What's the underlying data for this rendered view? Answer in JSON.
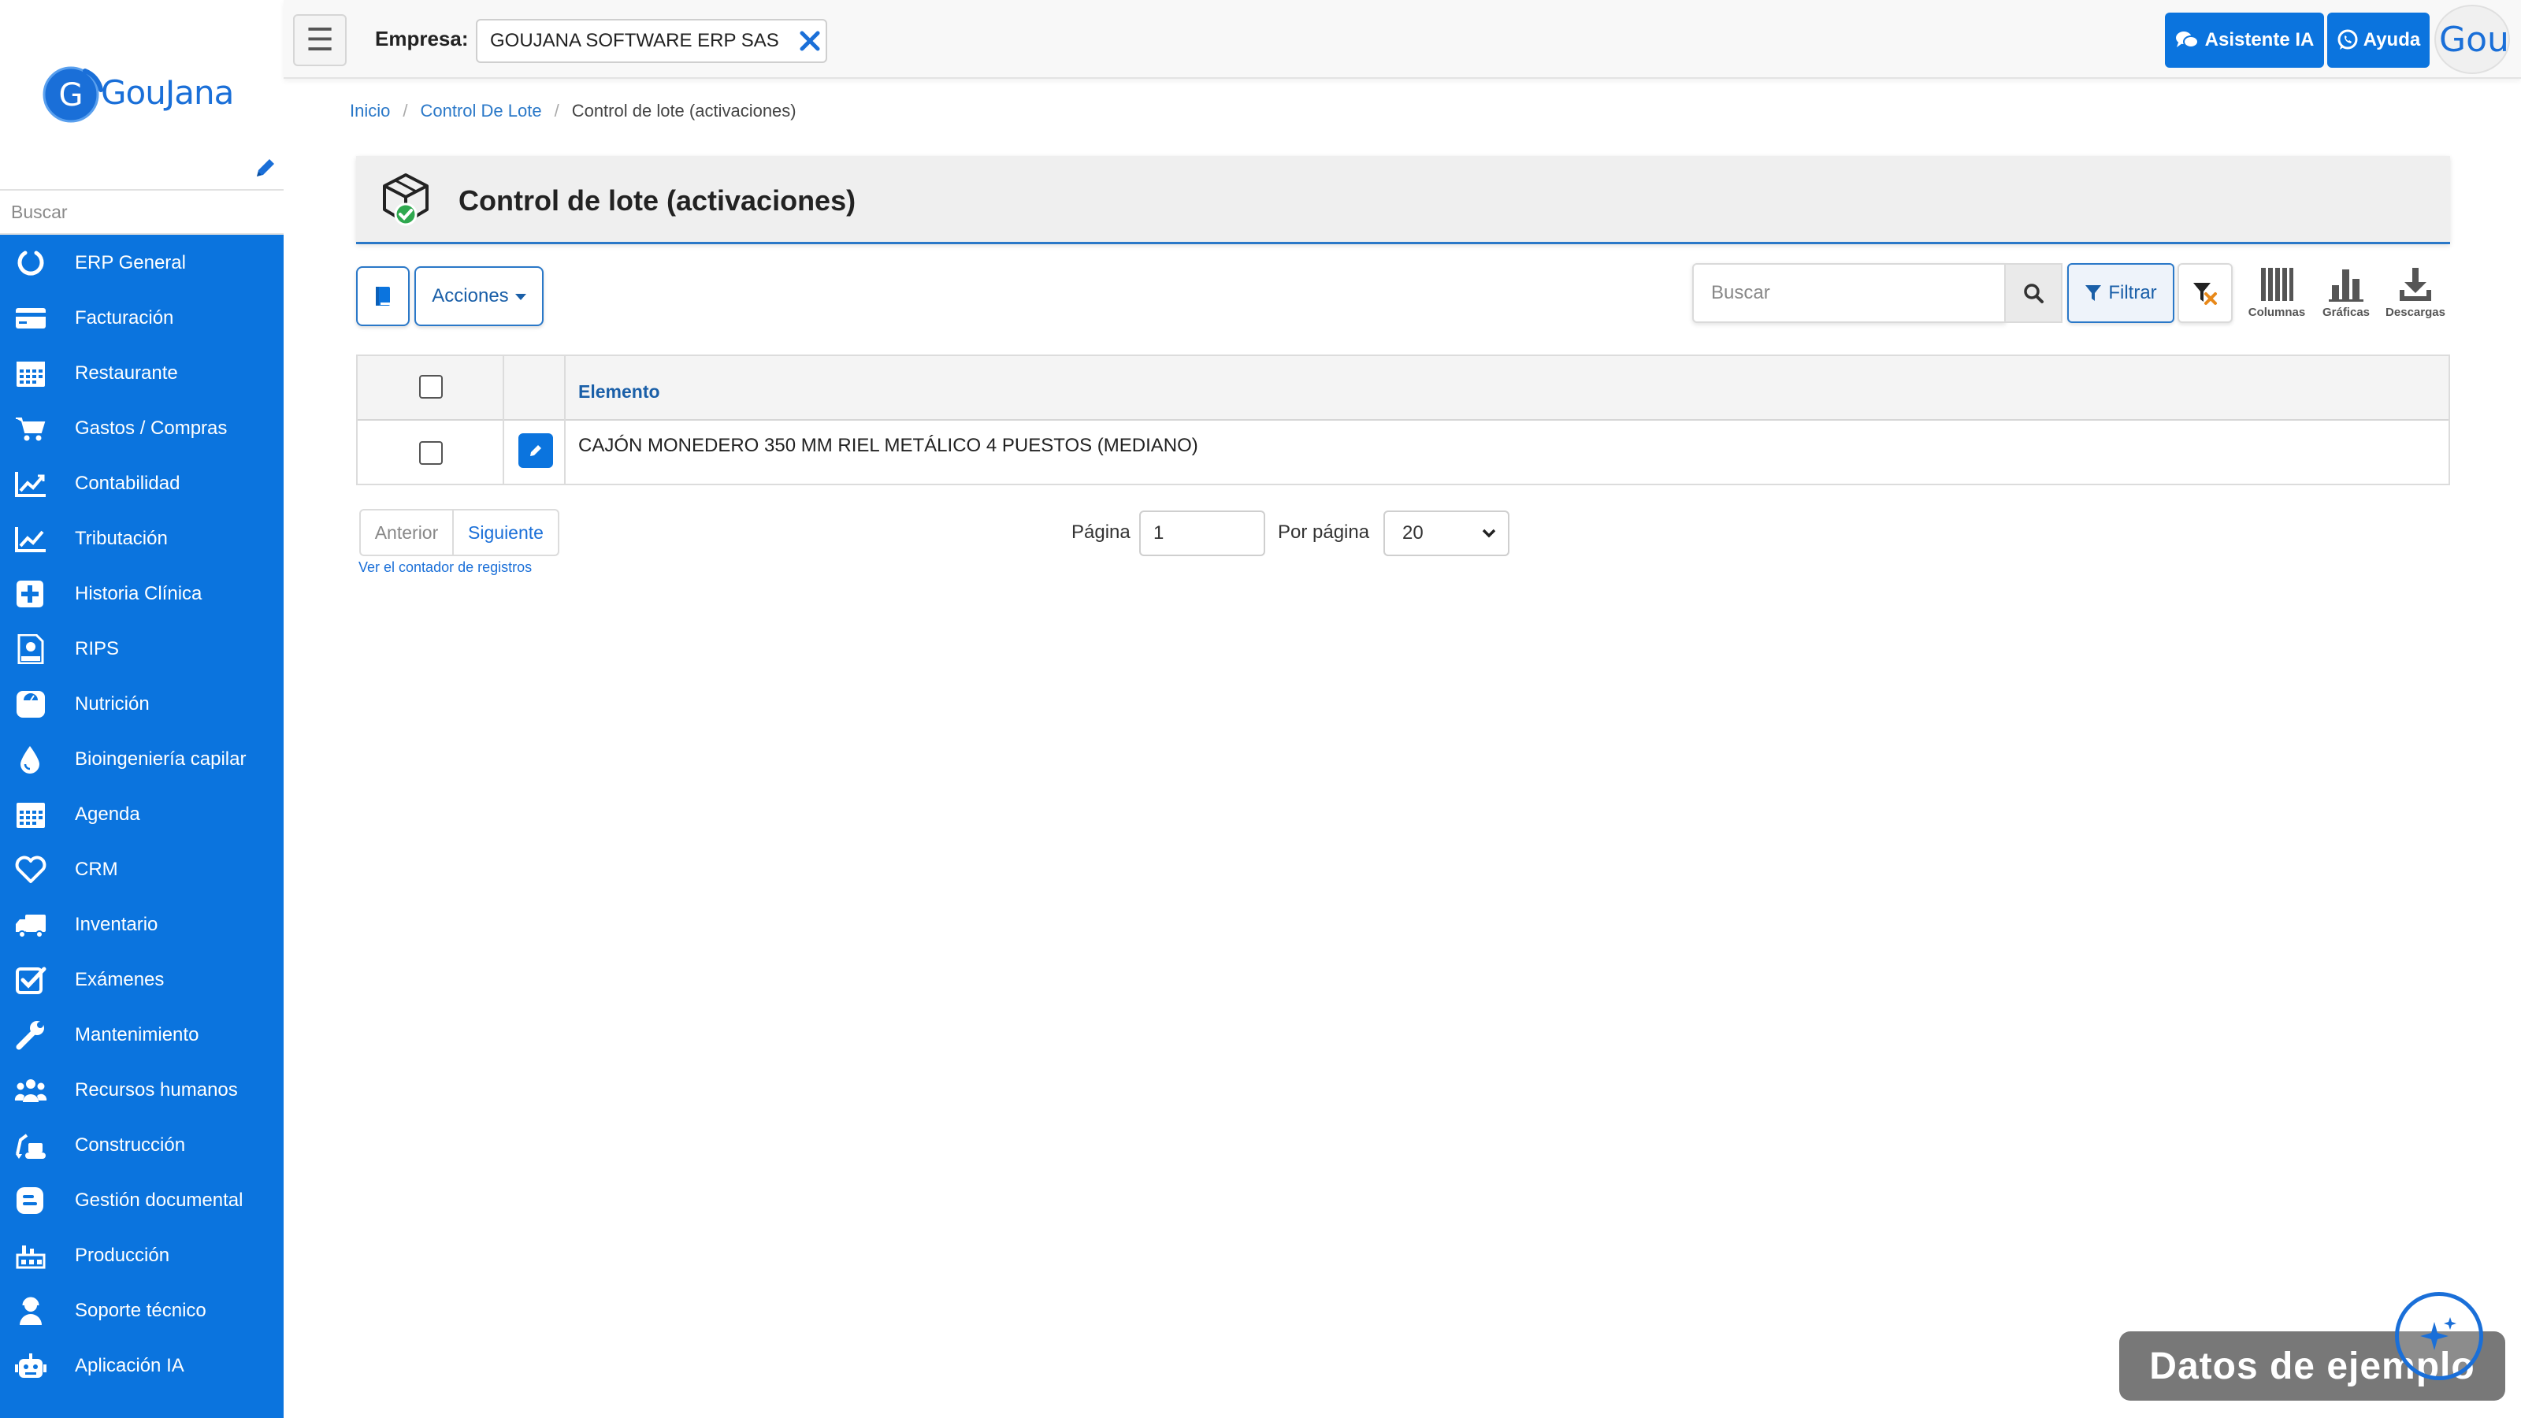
{
  "brand": {
    "logo_text": "GouJana",
    "avatar_text": "Gou"
  },
  "sidebar": {
    "search_placeholder": "Buscar",
    "items": [
      {
        "label": "ERP General",
        "icon": "circle-notch-icon"
      },
      {
        "label": "Facturación",
        "icon": "credit-card-icon"
      },
      {
        "label": "Restaurante",
        "icon": "calendar-grid-icon"
      },
      {
        "label": "Gastos / Compras",
        "icon": "cart-icon"
      },
      {
        "label": "Contabilidad",
        "icon": "line-chart-icon"
      },
      {
        "label": "Tributación",
        "icon": "line-chart-icon"
      },
      {
        "label": "Historia Clínica",
        "icon": "medical-plus-icon"
      },
      {
        "label": "RIPS",
        "icon": "rips-document-icon"
      },
      {
        "label": "Nutrición",
        "icon": "scale-icon"
      },
      {
        "label": "Bioingeniería capilar",
        "icon": "droplet-icon"
      },
      {
        "label": "Agenda",
        "icon": "calendar-grid-icon"
      },
      {
        "label": "CRM",
        "icon": "heart-icon"
      },
      {
        "label": "Inventario",
        "icon": "truck-icon"
      },
      {
        "label": "Exámenes",
        "icon": "check-square-icon"
      },
      {
        "label": "Mantenimiento",
        "icon": "wrench-icon"
      },
      {
        "label": "Recursos humanos",
        "icon": "users-icon"
      },
      {
        "label": "Construcción",
        "icon": "excavator-icon"
      },
      {
        "label": "Gestión documental",
        "icon": "blog-icon"
      },
      {
        "label": "Producción",
        "icon": "factory-icon"
      },
      {
        "label": "Soporte técnico",
        "icon": "support-agent-icon"
      },
      {
        "label": "Aplicación IA",
        "icon": "robot-icon"
      }
    ]
  },
  "topbar": {
    "menu_glyph": "☰",
    "empresa_label": "Empresa:",
    "empresa_value": "GOUJANA SOFTWARE ERP SAS",
    "asistente_label": "Asistente IA",
    "ayuda_label": "Ayuda"
  },
  "breadcrumb": {
    "home": "Inicio",
    "parent": "Control De Lote",
    "current": "Control de lote (activaciones)"
  },
  "page": {
    "title": "Control de lote (activaciones)"
  },
  "toolbar": {
    "acciones_label": "Acciones",
    "search_placeholder": "Buscar",
    "filter_label": "Filtrar",
    "tools": [
      {
        "label": "Columnas",
        "icon": "columns-icon"
      },
      {
        "label": "Gráficas",
        "icon": "bar-chart-icon"
      },
      {
        "label": "Descargas",
        "icon": "download-icon"
      }
    ]
  },
  "table": {
    "columns": [
      "Elemento"
    ],
    "rows": [
      {
        "elemento": "CAJÓN MONEDERO 350 MM RIEL METÁLICO 4 PUESTOS (MEDIANO)"
      }
    ]
  },
  "pagination": {
    "prev_label": "Anterior",
    "next_label": "Siguiente",
    "counter_link": "Ver el contador de registros",
    "page_label": "Página",
    "page_value": "1",
    "per_page_label": "Por página",
    "per_page_value": "20"
  },
  "watermark": {
    "label": "Datos de ejemplo"
  },
  "colors": {
    "primary": "#0b74de",
    "link": "#2a78c8",
    "header_bg": "#efefef"
  }
}
